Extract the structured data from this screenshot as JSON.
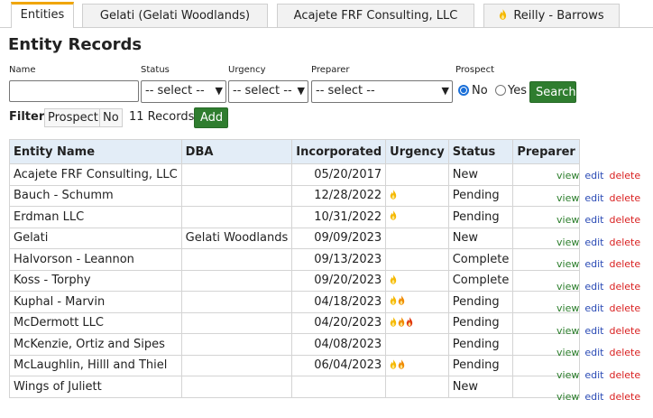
{
  "tabs": [
    {
      "label": "Entities",
      "active": true,
      "flame": false
    },
    {
      "label": "Gelati (Gelati Woodlands)",
      "active": false,
      "flame": false
    },
    {
      "label": "Acajete FRF Consulting, LLC",
      "active": false,
      "flame": false
    },
    {
      "label": "Reilly - Barrows",
      "active": false,
      "flame": true
    }
  ],
  "page_title": "Entity Records",
  "filters": {
    "name_label": "Name",
    "name_value": "",
    "status_label": "Status",
    "status_value": "-- select --",
    "urgency_label": "Urgency",
    "urgency_value": "-- select --",
    "preparer_label": "Preparer",
    "preparer_value": "-- select --",
    "prospect_label": "Prospect",
    "prospect_no": "No",
    "prospect_yes": "Yes",
    "prospect_selected": "No",
    "search_label": "Search"
  },
  "filter_bar": {
    "label": "Filter",
    "prospect_chip": "Prospect",
    "no_chip": "No",
    "records_text": "11 Records",
    "add_label": "Add"
  },
  "colors": {
    "urgency_low": "#f5b800",
    "urgency_mid": "#f08a00",
    "urgency_high": "#e03a10",
    "button": "#2f7d2f"
  },
  "table": {
    "headers": [
      "Entity Name",
      "DBA",
      "Incorporated",
      "Urgency",
      "Status",
      "Preparer"
    ],
    "rows": [
      {
        "name": "Acajete FRF Consulting, LLC",
        "dba": "",
        "incorporated": "05/20/2017",
        "urgency": 0,
        "status": "New",
        "preparer": ""
      },
      {
        "name": "Bauch - Schumm",
        "dba": "",
        "incorporated": "12/28/2022",
        "urgency": 1,
        "status": "Pending",
        "preparer": ""
      },
      {
        "name": "Erdman LLC",
        "dba": "",
        "incorporated": "10/31/2022",
        "urgency": 1,
        "status": "Pending",
        "preparer": ""
      },
      {
        "name": "Gelati",
        "dba": "Gelati Woodlands",
        "incorporated": "09/09/2023",
        "urgency": 0,
        "status": "New",
        "preparer": ""
      },
      {
        "name": "Halvorson - Leannon",
        "dba": "",
        "incorporated": "09/13/2023",
        "urgency": 0,
        "status": "Complete",
        "preparer": ""
      },
      {
        "name": "Koss - Torphy",
        "dba": "",
        "incorporated": "09/20/2023",
        "urgency": 1,
        "status": "Complete",
        "preparer": ""
      },
      {
        "name": "Kuphal - Marvin",
        "dba": "",
        "incorporated": "04/18/2023",
        "urgency": 2,
        "status": "Pending",
        "preparer": ""
      },
      {
        "name": "McDermott LLC",
        "dba": "",
        "incorporated": "04/20/2023",
        "urgency": 3,
        "status": "Pending",
        "preparer": ""
      },
      {
        "name": "McKenzie, Ortiz and Sipes",
        "dba": "",
        "incorporated": "04/08/2023",
        "urgency": 0,
        "status": "Pending",
        "preparer": ""
      },
      {
        "name": "McLaughlin, Hilll and Thiel",
        "dba": "",
        "incorporated": "06/04/2023",
        "urgency": 2,
        "status": "Pending",
        "preparer": ""
      },
      {
        "name": "Wings of Juliett",
        "dba": "",
        "incorporated": "",
        "urgency": 0,
        "status": "New",
        "preparer": ""
      }
    ],
    "actions": {
      "view": "view",
      "edit": "edit",
      "delete": "delete"
    }
  }
}
